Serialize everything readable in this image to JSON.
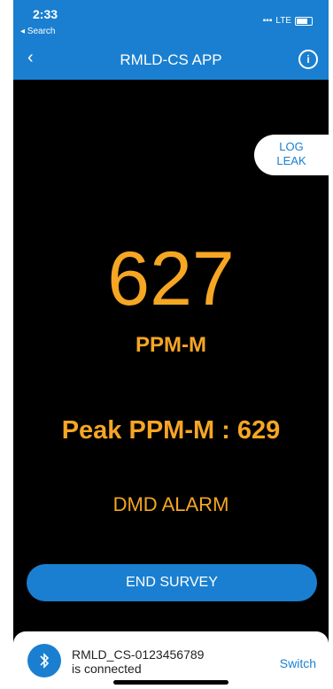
{
  "status": {
    "time": "2:33",
    "back_label": "◂ Search",
    "network": "LTE"
  },
  "nav": {
    "back_icon": "chevron-left-icon",
    "title": "RMLD-CS APP",
    "info_icon": "info-icon"
  },
  "log_leak": {
    "line1": "LOG",
    "line2": "LEAK"
  },
  "reading": {
    "value": "627",
    "unit": "PPM-M",
    "peak": "Peak PPM-M : 629",
    "alarm": "DMD ALARM"
  },
  "end_button": {
    "label": "END SURVEY"
  },
  "bluetooth": {
    "device": "RMLD_CS-0123456789",
    "status": "is connected",
    "switch_label": "Switch"
  },
  "colors": {
    "accent": "#1a7fd0",
    "reading": "#f5a623"
  }
}
